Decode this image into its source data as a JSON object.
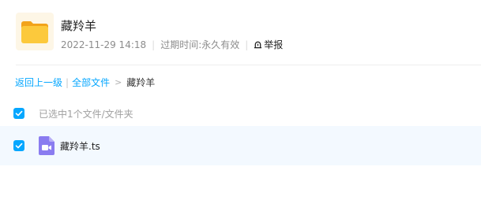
{
  "header": {
    "title": "藏羚羊",
    "date": "2022-11-29 14:18",
    "expire_label": "过期时间:",
    "expire_value": "永久有效",
    "report_label": "举报"
  },
  "breadcrumb": {
    "back_label": "返回上一级",
    "all_files_label": "全部文件",
    "current": "藏羚羊"
  },
  "selection": {
    "summary": "已选中1个文件/文件夹",
    "checked": true
  },
  "files": [
    {
      "name": "藏羚羊.ts",
      "icon": "video-file-icon",
      "checked": true
    }
  ],
  "colors": {
    "accent": "#06a7ff",
    "folder": "#f7c03b",
    "video_icon": "#8a7cf0",
    "row_highlight": "#f3f9ff"
  }
}
